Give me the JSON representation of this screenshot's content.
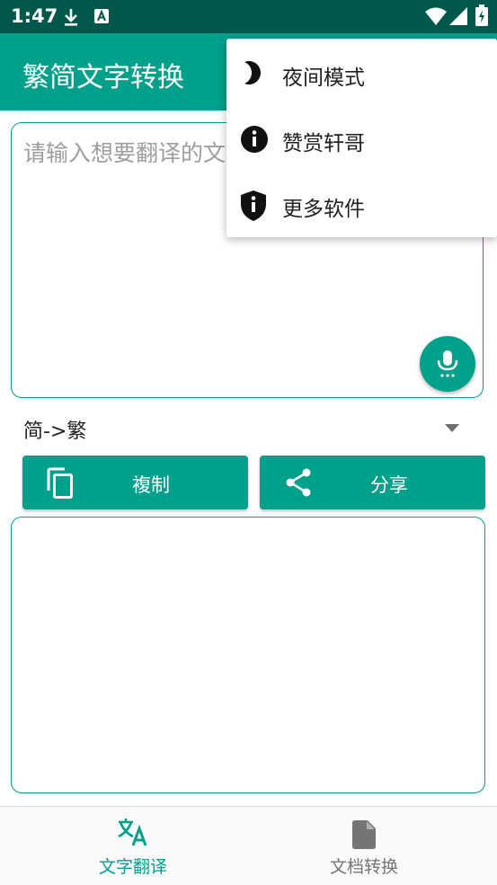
{
  "status_bar": {
    "time": "1:47",
    "icons": [
      "download-icon",
      "a-icon",
      "wifi-icon",
      "signal-icon",
      "battery-icon"
    ]
  },
  "app_bar": {
    "title": "繁简文字转换"
  },
  "input": {
    "placeholder": "请输入想要翻译的文"
  },
  "spinner": {
    "selected": "简->繁"
  },
  "actions": {
    "copy_label": "複制",
    "share_label": "分享"
  },
  "bottom_nav": {
    "items": [
      {
        "label": "文字翻译",
        "icon": "translate-icon",
        "active": true
      },
      {
        "label": "文档转换",
        "icon": "file-icon",
        "active": false
      }
    ]
  },
  "menu": {
    "items": [
      {
        "label": "夜间模式",
        "icon": "moon-icon"
      },
      {
        "label": "赞赏轩哥",
        "icon": "info-icon"
      },
      {
        "label": "更多软件",
        "icon": "shield-info-icon"
      }
    ]
  },
  "colors": {
    "status_bar": "#00574a",
    "primary": "#00a08a",
    "nav_inactive": "#757575"
  }
}
